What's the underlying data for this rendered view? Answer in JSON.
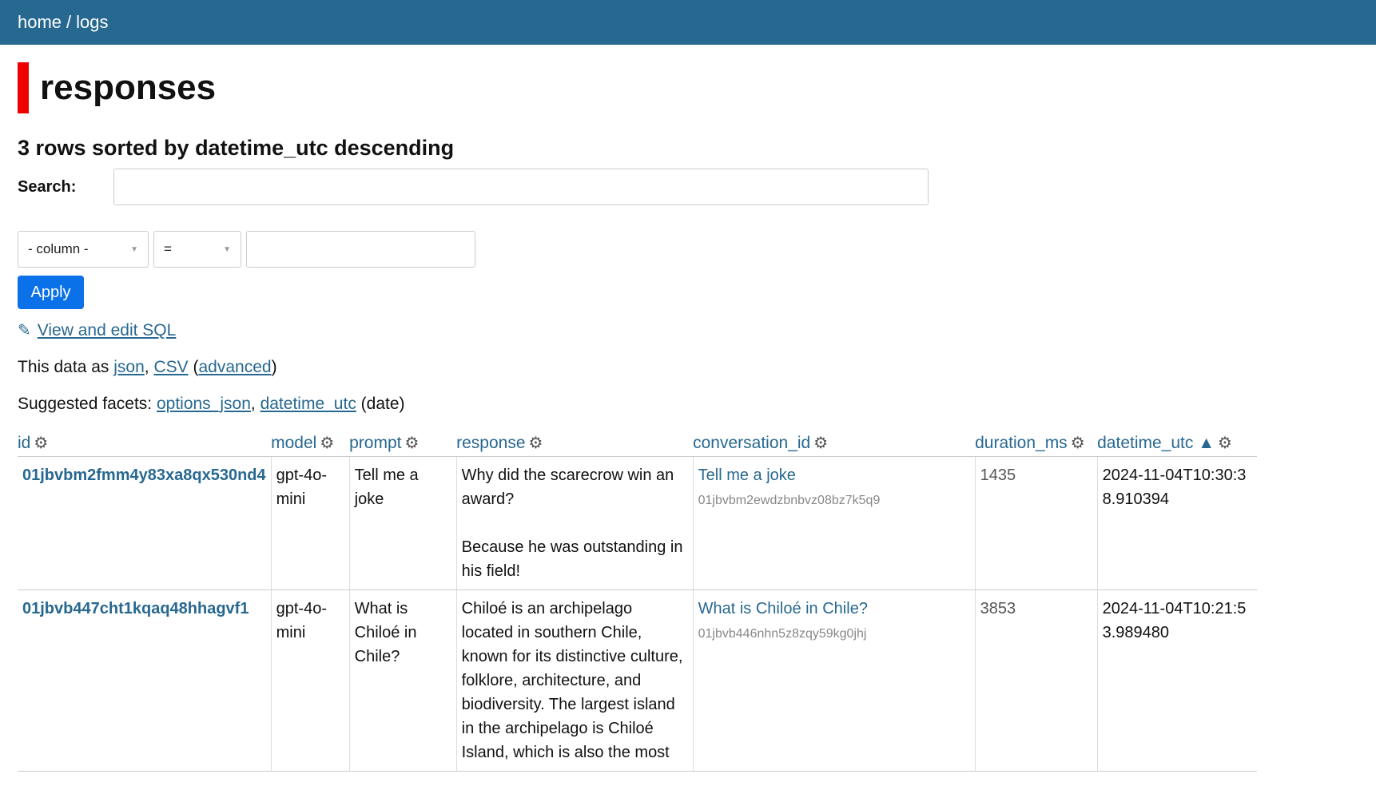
{
  "nav": {
    "home": "home",
    "sep": "/",
    "logs": "logs"
  },
  "page": {
    "title": "responses",
    "subtitle": "3 rows sorted by datetime_utc descending"
  },
  "search": {
    "label": "Search:",
    "value": ""
  },
  "filter": {
    "column": "- column -",
    "op": "=",
    "value": "",
    "apply": "Apply"
  },
  "sql_link": "View and edit SQL",
  "export": {
    "prefix": "This data as",
    "json": "json",
    "comma": ",",
    "csv": "CSV",
    "open": "(",
    "advanced": "advanced",
    "close": ")"
  },
  "facets": {
    "prefix": "Suggested facets:",
    "f1": "options_json",
    "comma": ",",
    "f2": "datetime_utc",
    "suffix": "(date)"
  },
  "table": {
    "columns": [
      "id",
      "model",
      "prompt",
      "response",
      "conversation_id",
      "duration_ms",
      "datetime_utc"
    ],
    "sort_indicator": "▲",
    "rows": [
      {
        "id": "01jbvbm2fmm4y83xa8qx530nd4",
        "model": "gpt-4o-mini",
        "prompt": "Tell me a joke",
        "response": "Why did the scarecrow win an award?\n\nBecause he was outstanding in his field!",
        "conversation_title": "Tell me a joke",
        "conversation_id": "01jbvbm2ewdzbnbvz08bz7k5q9",
        "duration_ms": "1435",
        "datetime_utc": "2024-11-04T10:30:38.910394"
      },
      {
        "id": "01jbvb447cht1kqaq48hhagvf1",
        "model": "gpt-4o-mini",
        "prompt": "What is Chiloé in Chile?",
        "response": "Chiloé is an archipelago located in southern Chile, known for its distinctive culture, folklore, architecture, and biodiversity. The largest island in the archipelago is Chiloé Island, which is also the most",
        "conversation_title": "What is Chiloé in Chile?",
        "conversation_id": "01jbvb446nhn5z8zqy59kg0jhj",
        "duration_ms": "3853",
        "datetime_utc": "2024-11-04T10:21:53.989480"
      }
    ]
  },
  "icons": {
    "gear": "gear-icon",
    "pencil": "pencil-icon"
  }
}
